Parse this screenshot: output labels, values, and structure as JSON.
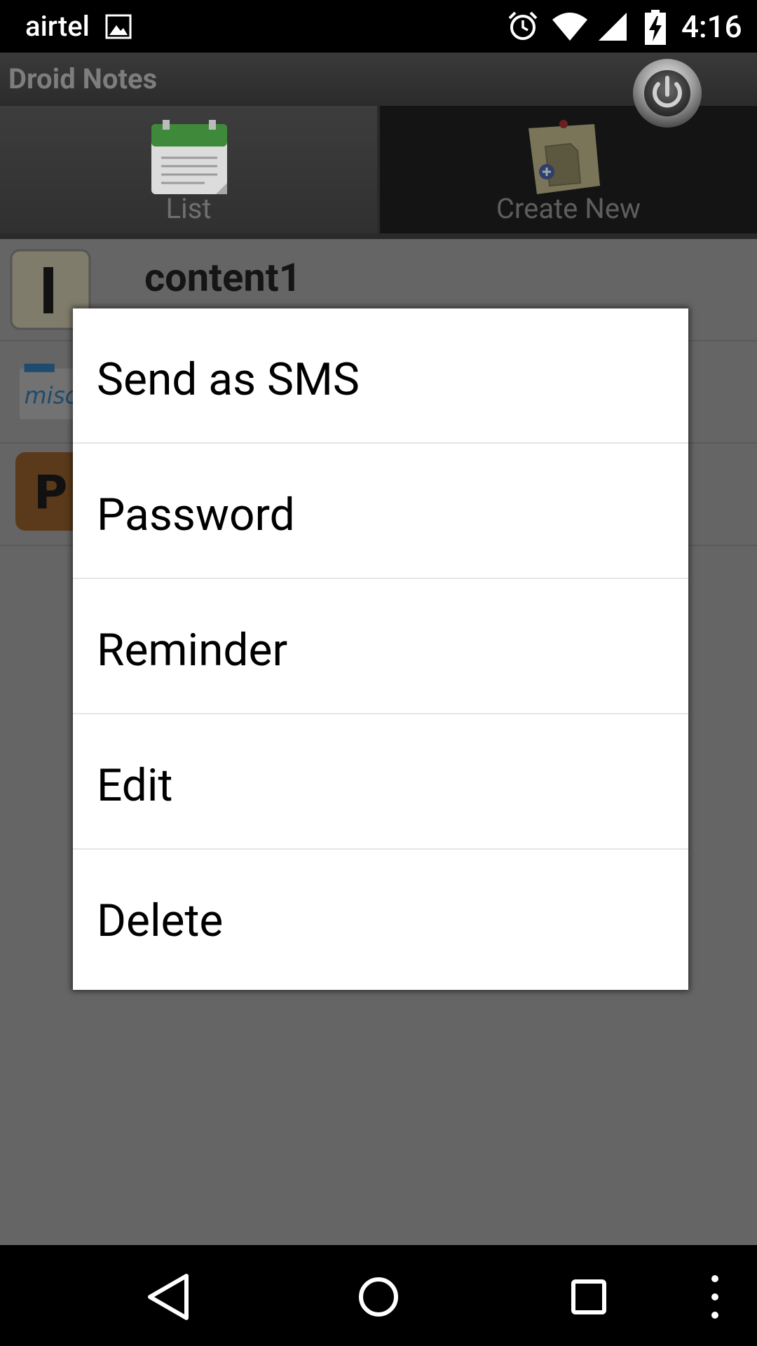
{
  "status_bar": {
    "carrier": "airtel",
    "time": "4:16",
    "icons": [
      "gallery-icon",
      "alarm-icon",
      "wifi-icon",
      "signal-icon",
      "battery-charging-icon"
    ]
  },
  "header": {
    "title": "Droid Notes",
    "power_icon": "power-icon"
  },
  "tabs": [
    {
      "label": "List",
      "icon": "calendar-list-icon",
      "selected": true
    },
    {
      "label": "Create New",
      "icon": "note-add-icon",
      "selected": false
    }
  ],
  "notes": [
    {
      "title": "content1",
      "thumb": "letter-tile-I"
    },
    {
      "title": "",
      "thumb": "misc-folder-icon"
    },
    {
      "title": "",
      "thumb": "letter-tile-P"
    }
  ],
  "context_menu": {
    "items": [
      {
        "label": "Send as SMS"
      },
      {
        "label": "Password"
      },
      {
        "label": "Reminder"
      },
      {
        "label": "Edit"
      },
      {
        "label": "Delete"
      }
    ]
  },
  "nav_bar": {
    "icons": [
      "back-icon",
      "home-icon",
      "recents-icon",
      "overflow-menu-icon"
    ]
  },
  "colors": {
    "overlay": "#656565",
    "dialog_bg": "#ffffff",
    "header_title": "#7d7d7d"
  }
}
